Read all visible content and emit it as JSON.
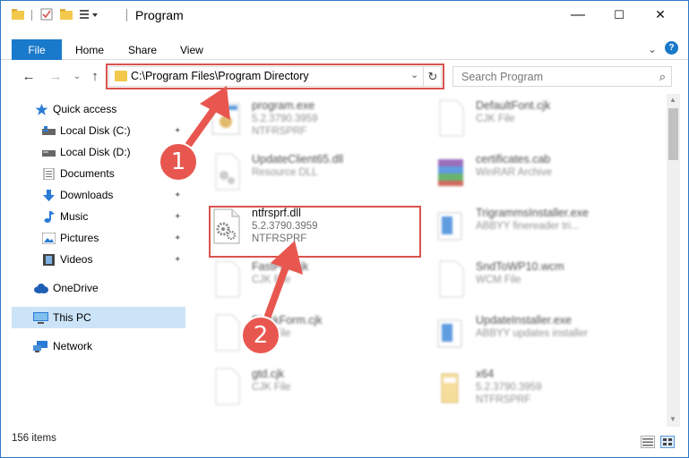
{
  "window": {
    "title": "Program",
    "minimize": "—",
    "maximize": "☐",
    "close": "✕"
  },
  "ribbon": {
    "tabs": [
      "File",
      "Home",
      "Share",
      "View"
    ],
    "expand": "⌄",
    "help": "?"
  },
  "navigation": {
    "back": "←",
    "forward": "→",
    "recent": "⌄",
    "up": "↑"
  },
  "address": {
    "path": "C:\\Program Files\\Program Directory",
    "dropdown": "⌄",
    "refresh": "↻"
  },
  "search": {
    "placeholder": "Search Program",
    "icon": "⌕"
  },
  "sidebar": {
    "items": [
      {
        "label": "Quick access",
        "icon": "star-icon",
        "pinned": false
      },
      {
        "label": "Local Disk (C:)",
        "icon": "drive-icon",
        "pinned": true
      },
      {
        "label": "Local Disk (D:)",
        "icon": "drive-icon",
        "pinned": true
      },
      {
        "label": "Documents",
        "icon": "documents-icon",
        "pinned": true
      },
      {
        "label": "Downloads",
        "icon": "downloads-icon",
        "pinned": true
      },
      {
        "label": "Music",
        "icon": "music-icon",
        "pinned": true
      },
      {
        "label": "Pictures",
        "icon": "pictures-icon",
        "pinned": true
      },
      {
        "label": "Videos",
        "icon": "videos-icon",
        "pinned": true
      },
      {
        "label": "OneDrive",
        "icon": "cloud-icon",
        "pinned": false
      },
      {
        "label": "This PC",
        "icon": "computer-icon",
        "pinned": false
      },
      {
        "label": "Network",
        "icon": "network-icon",
        "pinned": false
      }
    ],
    "pin_glyph": "📌"
  },
  "files": [
    {
      "name": "program.exe",
      "meta1": "5.2.3790.3959",
      "meta2": "NTFRSPRF",
      "blurred": true
    },
    {
      "name": "DefaultFont.cjk",
      "meta1": "CJK File",
      "meta2": "",
      "blurred": true
    },
    {
      "name": "UpdateClient65.dll",
      "meta1": "Resource DLL",
      "meta2": "",
      "blurred": true
    },
    {
      "name": "certificates.cab",
      "meta1": "WinRAR Archive",
      "meta2": "",
      "blurred": true
    },
    {
      "name": "ntfrsprf.dll",
      "meta1": "5.2.3790.3959",
      "meta2": "NTFRSPRF",
      "blurred": false
    },
    {
      "name": "TrigrammsInstaller.exe",
      "meta1": "ABBYY finereader tri...",
      "meta2": "",
      "blurred": true
    },
    {
      "name": "FastFile.cjk",
      "meta1": "CJK File",
      "meta2": "",
      "blurred": true
    },
    {
      "name": "SndToWP10.wcm",
      "meta1": "WCM File",
      "meta2": "",
      "blurred": true
    },
    {
      "name": "BlockForm.cjk",
      "meta1": "CJK File",
      "meta2": "",
      "blurred": true
    },
    {
      "name": "UpdateInstaller.exe",
      "meta1": "ABBYY updates installer",
      "meta2": "",
      "blurred": true
    },
    {
      "name": "gtd.cjk",
      "meta1": "CJK File",
      "meta2": "",
      "blurred": true
    },
    {
      "name": "x64",
      "meta1": "5.2.3790.3959",
      "meta2": "NTFRSPRF",
      "blurred": true
    }
  ],
  "status": {
    "item_count": "156 items"
  },
  "annotations": {
    "step1": "1",
    "step2": "2"
  },
  "colors": {
    "accent": "#1979ca",
    "annotation": "#d9534f",
    "selected": "#cce4f7"
  }
}
